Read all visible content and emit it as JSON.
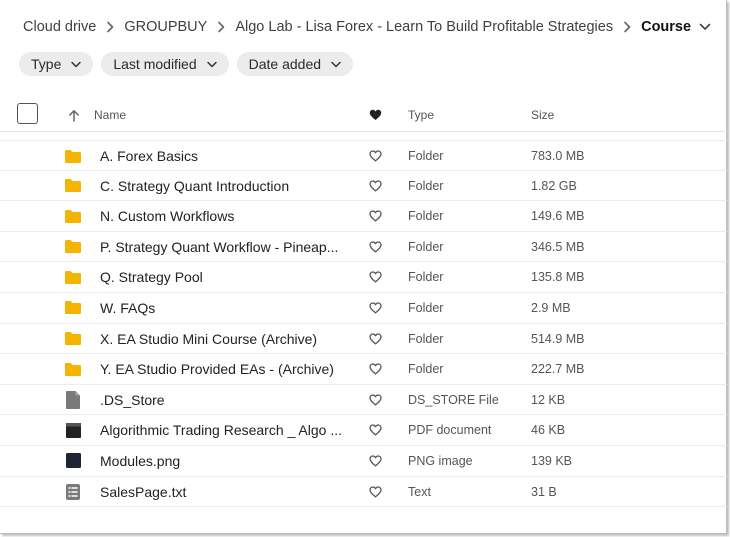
{
  "breadcrumb": {
    "items": [
      "Cloud drive",
      "GROUPBUY",
      "Algo Lab - Lisa Forex - Learn To Build Profitable Strategies"
    ],
    "current": "Course",
    "separator_icon": "chevron-right-icon",
    "current_menu_icon": "chevron-down-icon"
  },
  "filters": [
    {
      "label": "Type"
    },
    {
      "label": "Last modified"
    },
    {
      "label": "Date added"
    }
  ],
  "table": {
    "headers": {
      "name": "Name",
      "type": "Type",
      "size": "Size"
    },
    "sort_icon": "arrow-up-icon",
    "favourite_header_icon": "heart-filled-icon",
    "rows": [
      {
        "name": "A. Forex Basics",
        "type": "Folder",
        "size": "783.0 MB",
        "icon": "folder-icon"
      },
      {
        "name": "C. Strategy Quant Introduction",
        "type": "Folder",
        "size": "1.82 GB",
        "icon": "folder-icon"
      },
      {
        "name": "N. Custom Workflows",
        "type": "Folder",
        "size": "149.6 MB",
        "icon": "folder-icon"
      },
      {
        "name": "P. Strategy Quant Workflow - Pineap...",
        "type": "Folder",
        "size": "346.5 MB",
        "icon": "folder-icon"
      },
      {
        "name": "Q. Strategy Pool",
        "type": "Folder",
        "size": "135.8 MB",
        "icon": "folder-icon"
      },
      {
        "name": "W. FAQs",
        "type": "Folder",
        "size": "2.9 MB",
        "icon": "folder-icon"
      },
      {
        "name": "X. EA Studio Mini Course (Archive)",
        "type": "Folder",
        "size": "514.9 MB",
        "icon": "folder-icon"
      },
      {
        "name": "Y. EA Studio Provided EAs - (Archive)",
        "type": "Folder",
        "size": "222.7 MB",
        "icon": "folder-icon"
      },
      {
        "name": ".DS_Store",
        "type": "DS_STORE File",
        "size": "12 KB",
        "icon": "generic-file-icon"
      },
      {
        "name": "Algorithmic Trading Research _ Algo ...",
        "type": "PDF document",
        "size": "46 KB",
        "icon": "pdf-file-icon"
      },
      {
        "name": "Modules.png",
        "type": "PNG image",
        "size": "139 KB",
        "icon": "image-file-icon"
      },
      {
        "name": "SalesPage.txt",
        "type": "Text",
        "size": "31 B",
        "icon": "text-file-icon"
      }
    ]
  },
  "colors": {
    "folder": "#F5B400",
    "chip_bg": "#ECECEC",
    "file_icon": "#7A7A7A",
    "dark_file_icon": "#1E2433"
  }
}
